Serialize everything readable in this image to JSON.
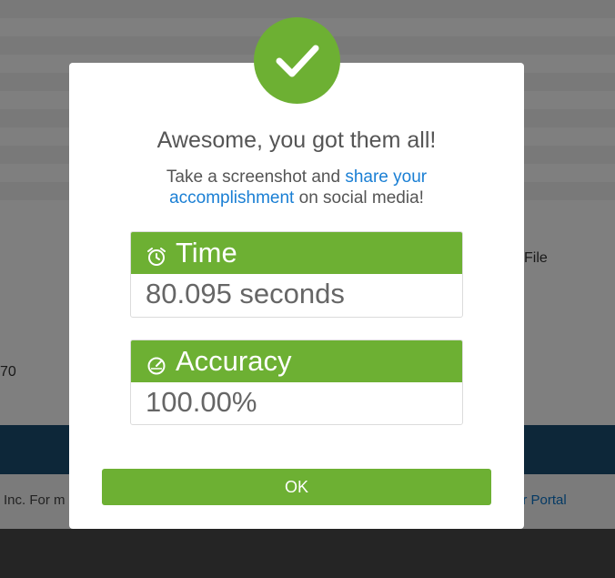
{
  "background": {
    "file_label": "File",
    "partial_number": "70",
    "footer_left": "Inc. For m",
    "footer_right": "er Portal"
  },
  "modal": {
    "title": "Awesome, you got them all!",
    "subtitle_before": "Take a screenshot and ",
    "share_link": "share your accomplishment",
    "subtitle_after": " on social media!",
    "time": {
      "label": "Time",
      "value": "80.095 seconds",
      "icon": "alarm-clock-icon"
    },
    "accuracy": {
      "label": "Accuracy",
      "value": "100.00%",
      "icon": "gauge-icon"
    },
    "ok_label": "OK",
    "check_icon": "checkmark-icon"
  },
  "colors": {
    "accent_green": "#6db033",
    "link_blue": "#1a7fd4",
    "band_blue": "#1b4f72"
  }
}
